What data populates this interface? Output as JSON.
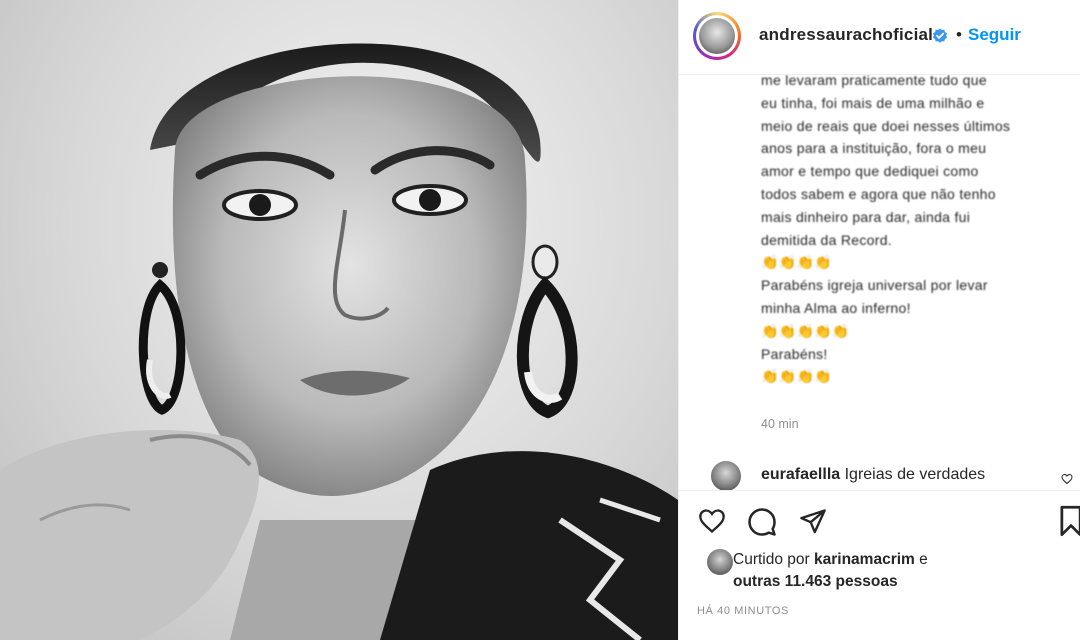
{
  "header": {
    "username": "andressaurachoficial",
    "separator": "•",
    "follow_label": "Seguir"
  },
  "caption": {
    "lines": [
      "me levaram praticamente tudo que",
      "eu tinha, foi mais de uma milhão e",
      "meio de reais que doei nesses últimos",
      "anos para a instituição, fora o meu",
      "amor e tempo que dediquei como",
      "todos sabem e agora que não tenho",
      "mais dinheiro para dar, ainda fui",
      "demitida da Record."
    ],
    "emoji1": "👏👏👏👏",
    "line2a": "Parabéns igreja universal por levar",
    "line2b": "minha Alma ao inferno!",
    "emoji2": "👏👏👏👏👏",
    "line3": "Parabéns!",
    "emoji3": "👏👏👏👏",
    "time": "40 min"
  },
  "comment": {
    "username": "eurafaellla",
    "text": "Igreias de verdades"
  },
  "actions": {
    "liked_prefix": "Curtido por",
    "liked_user": "karinamacrim",
    "liked_and": "e",
    "liked_others": "outras 11.463 pessoas",
    "posted_ago": "HÁ 40 MINUTOS"
  },
  "colors": {
    "accent": "#0095f6",
    "text": "#262626",
    "muted": "#8e8e8e"
  }
}
